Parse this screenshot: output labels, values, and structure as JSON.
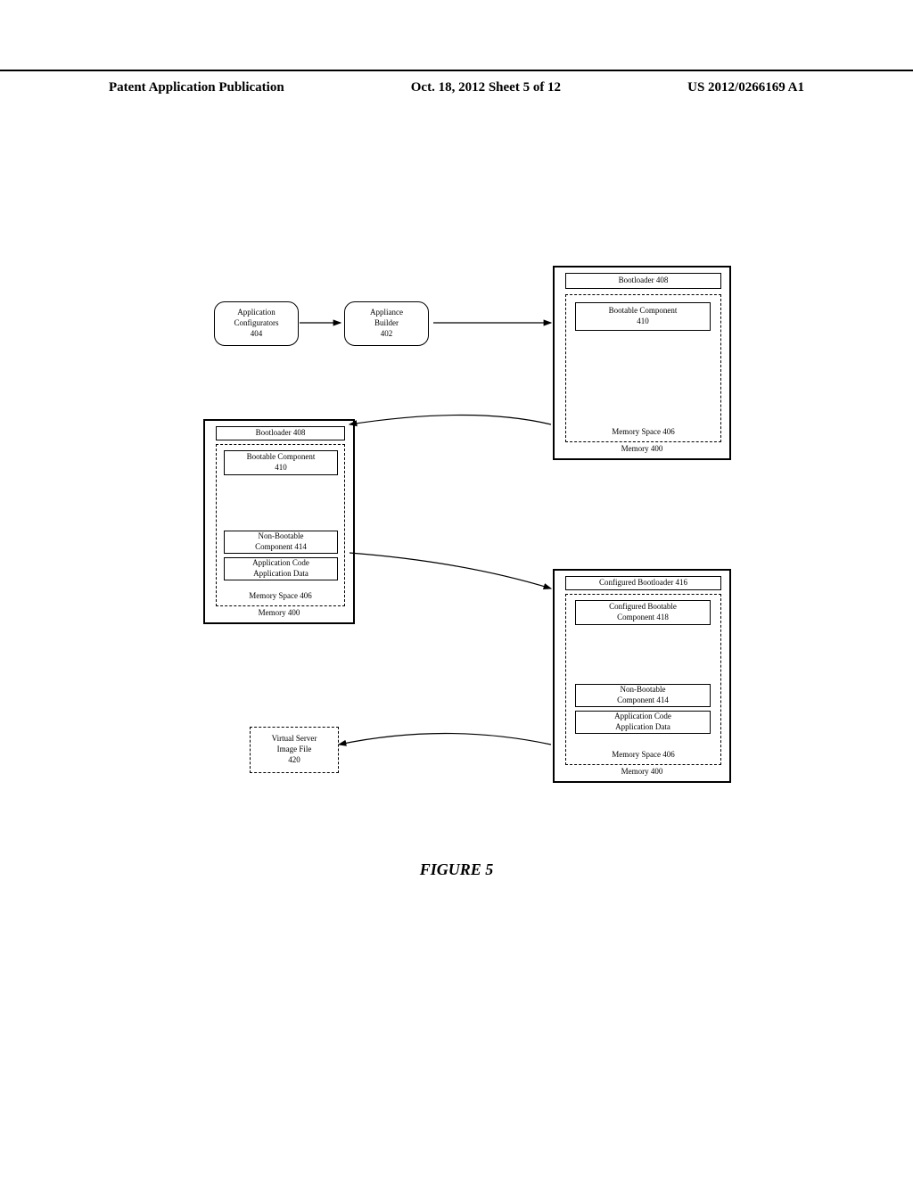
{
  "header": {
    "left": "Patent Application Publication",
    "middle": "Oct. 18, 2012   Sheet 5 of 12",
    "right": "US 2012/0266169 A1"
  },
  "diagram": {
    "app_configs": {
      "line1": "Application",
      "line2": "Configurators",
      "line3": "404"
    },
    "app_builder": {
      "line1": "Appliance",
      "line2": "Builder",
      "line3": "402"
    },
    "bootloader_top": "Bootloader 408",
    "bootable_component_top": {
      "line1": "Bootable Component",
      "line2": "410"
    },
    "memory_space_top": "Memory Space 406",
    "memory_top": "Memory 400",
    "bootloader_mid": "Bootloader 408",
    "bootable_component_mid": {
      "line1": "Bootable Component",
      "line2": "410"
    },
    "nonbootable_mid": {
      "line1": "Non-Bootable",
      "line2": "Component 414"
    },
    "appcode_mid": {
      "line1": "Application Code",
      "line2": "Application Data"
    },
    "memory_space_mid": "Memory Space 406",
    "memory_mid": "Memory 400",
    "configured_bootloader": "Configured Bootloader 416",
    "configured_bootable": {
      "line1": "Configured Bootable",
      "line2": "Component 418"
    },
    "nonbootable_bot": {
      "line1": "Non-Bootable",
      "line2": "Component 414"
    },
    "appcode_bot": {
      "line1": "Application Code",
      "line2": "Application Data"
    },
    "memory_space_bot": "Memory Space 406",
    "memory_bot": "Memory 400",
    "virtual_server": {
      "line1": "Virtual Server",
      "line2": "Image File",
      "line3": "420"
    }
  },
  "caption": "FIGURE 5"
}
